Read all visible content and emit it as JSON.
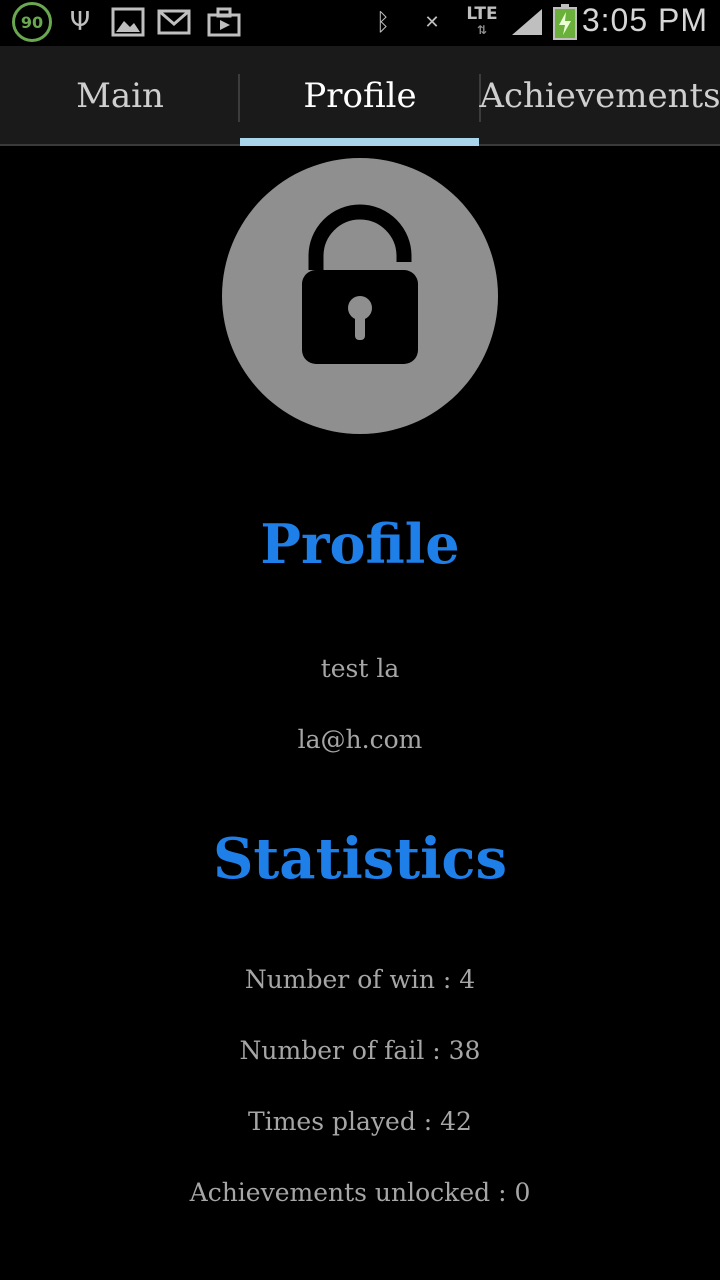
{
  "status_bar": {
    "notification_badge": "90",
    "network": "LTE",
    "time": "3:05 PM",
    "icons": [
      "usb-icon",
      "gallery-icon",
      "mail-icon",
      "bag-icon",
      "bluetooth-icon",
      "mute-icon",
      "lte-icon",
      "signal-icon",
      "battery-icon"
    ]
  },
  "tabs": [
    {
      "label": "Main"
    },
    {
      "label": "Profile",
      "selected": true
    },
    {
      "label": "Achievements"
    }
  ],
  "colors": {
    "accent_heading": "#1f7fe8",
    "tab_indicator": "#a9d4ea",
    "avatar_bg": "#8f8f8f"
  },
  "profile": {
    "heading": "Profile",
    "name": "test la",
    "email": "la@h.com",
    "avatar_icon": "lock-open-icon"
  },
  "statistics": {
    "heading": "Statistics",
    "wins": "Number of win : 4",
    "fails": "Number of fail : 38",
    "played": "Times played : 42",
    "achievements": "Achievements unlocked : 0"
  }
}
